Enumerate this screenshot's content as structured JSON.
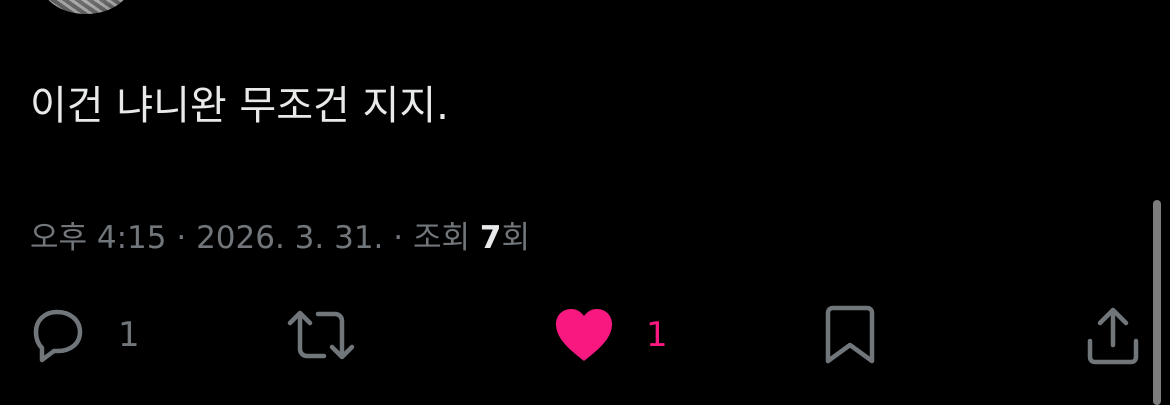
{
  "tweet": {
    "text": "이건 냐니완 무조건 지지."
  },
  "meta": {
    "time": "오후 4:15",
    "sep1": " · ",
    "date": "2026. 3. 31.",
    "sep2": " · ",
    "views_prefix": "조회 ",
    "views_count": "7",
    "views_suffix": "회"
  },
  "actions": {
    "reply": {
      "icon": "reply-icon",
      "count": "1"
    },
    "retweet": {
      "icon": "retweet-icon"
    },
    "like": {
      "icon": "heart-icon",
      "count": "1",
      "color": "#f91880",
      "liked": true
    },
    "bookmark": {
      "icon": "bookmark-icon"
    },
    "share": {
      "icon": "share-icon"
    }
  },
  "colors": {
    "background": "#000000",
    "text": "#e7e9ea",
    "secondary": "#71767b",
    "like": "#f91880"
  }
}
